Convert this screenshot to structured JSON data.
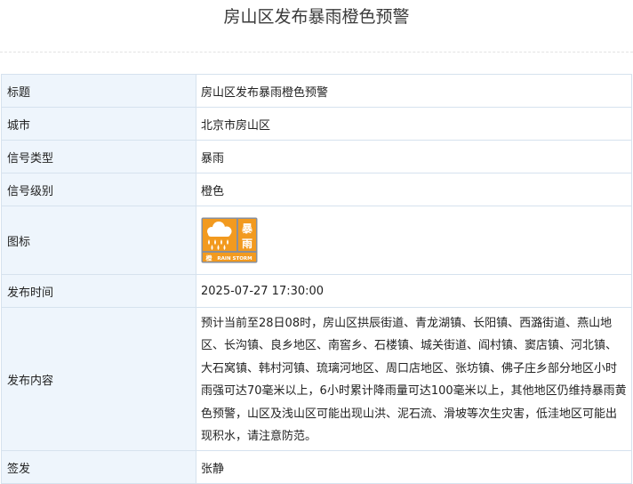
{
  "header": {
    "title": "房山区发布暴雨橙色预警"
  },
  "table": {
    "rows": [
      {
        "label": "标题",
        "value": "房山区发布暴雨橙色预警"
      },
      {
        "label": "城市",
        "value": "北京市房山区"
      },
      {
        "label": "信号类型",
        "value": "暴雨"
      },
      {
        "label": "信号级别",
        "value": "橙色"
      },
      {
        "label": "图标"
      },
      {
        "label": "发布时间",
        "value": "2025-07-27 17:30:00"
      },
      {
        "label": "发布内容",
        "value": "预计当前至28日08时，房山区拱辰街道、青龙湖镇、长阳镇、西潞街道、燕山地区、长沟镇、良乡地区、南窖乡、石楼镇、城关街道、阎村镇、窦店镇、河北镇、大石窝镇、韩村河镇、琉璃河地区、周口店地区、张坊镇、佛子庄乡部分地区小时雨强可达70毫米以上，6小时累计降雨量可达100毫米以上，其他地区仍维持暴雨黄色预警，山区及浅山区可能出现山洪、泥石流、滑坡等次生灾害，低洼地区可能出现积水，请注意防范。"
      },
      {
        "label": "签发",
        "value": "张静"
      }
    ]
  },
  "icon": {
    "name": "rainstorm-orange-warning-icon",
    "glyph_top": "暴",
    "glyph_mid": "雨",
    "glyph_bottom": "橙",
    "caption": "RAIN STORM",
    "colors": {
      "orange": "#f29a1f",
      "frame": "#8a8f98",
      "white": "#ffffff"
    }
  },
  "colors": {
    "label_bg": "#eef5fc",
    "border": "#d6e2ee",
    "text": "#222222"
  }
}
